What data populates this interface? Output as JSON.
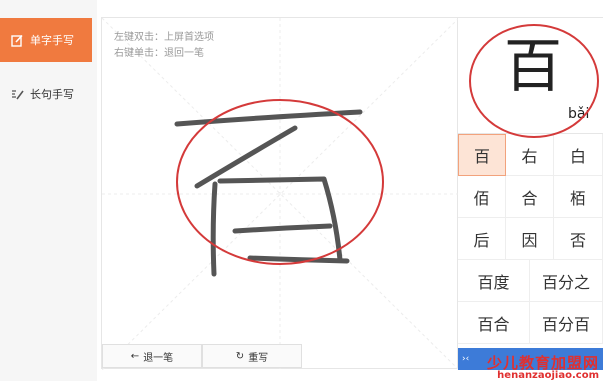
{
  "sidebar": {
    "items": [
      {
        "label": "单字手写",
        "icon": "edit-icon",
        "active": true
      },
      {
        "label": "长句手写",
        "icon": "pen-lines-icon",
        "active": false
      }
    ]
  },
  "pad": {
    "hint_line1": "左键双击：上屏首选项",
    "hint_line2": "右键单击：退回一笔",
    "undo_label": "退一笔",
    "redo_label": "重写"
  },
  "preview": {
    "char": "百",
    "pinyin": "bǎi"
  },
  "candidates": {
    "singles": [
      "百",
      "右",
      "白",
      "佰",
      "合",
      "栢",
      "后",
      "因",
      "否"
    ],
    "words": [
      "百度",
      "百分之",
      "百合",
      "百分百"
    ]
  },
  "pagebar": {
    "label": "›‹"
  },
  "watermark": {
    "title": "少儿教育加盟网",
    "url": "henanzaojiao.com"
  },
  "colors": {
    "accent": "#f07a3f",
    "highlight_circle": "#d43a3a",
    "stroke": "#555555",
    "pagebar": "#3d7bd8"
  }
}
